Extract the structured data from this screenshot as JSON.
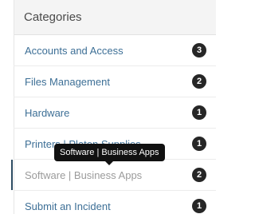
{
  "sidebar": {
    "title": "Categories",
    "items": [
      {
        "label": "Accounts and Access",
        "count": "3"
      },
      {
        "label": "Files Management",
        "count": "2"
      },
      {
        "label": "Hardware",
        "count": "1"
      },
      {
        "label": "Printers | Platen Supplies",
        "count": "1"
      },
      {
        "label": "Software | Business Apps",
        "count": "2"
      },
      {
        "label": "Submit an Incident",
        "count": "1"
      }
    ],
    "tooltip": "Software | Business Apps"
  }
}
